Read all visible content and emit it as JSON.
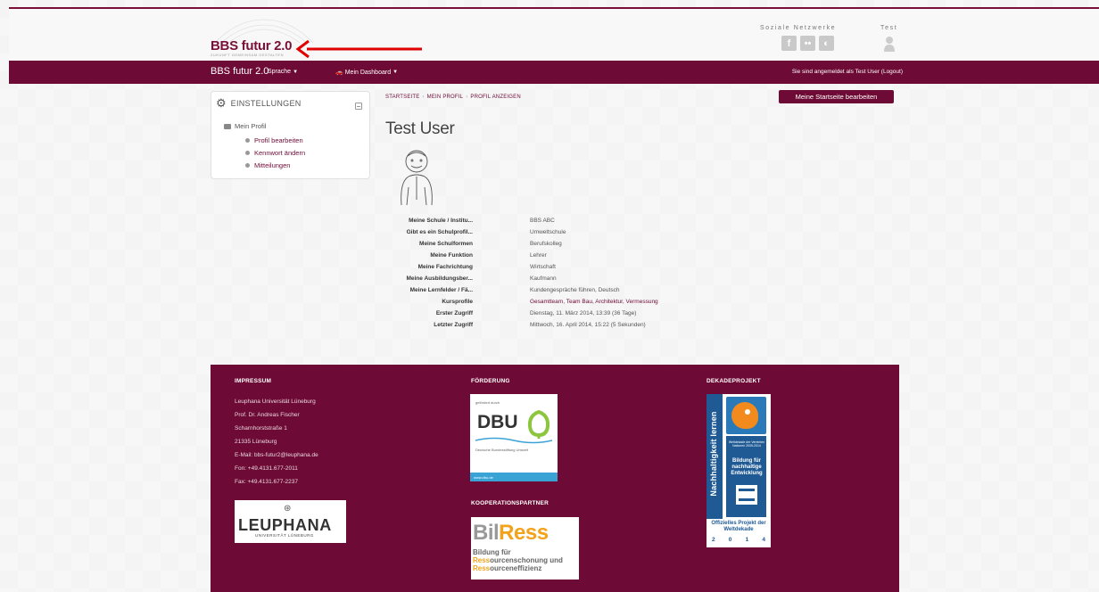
{
  "header": {
    "logo_title": "BBS futur 2.0",
    "logo_sub": "ZUKUNFT GEMEINSAM GESTALTEN",
    "social_title": "Soziale Netzwerke",
    "test_title": "Test",
    "social_icons": [
      "facebook-icon",
      "flickr-icon",
      "circle-icon"
    ]
  },
  "nav": {
    "brand": "BBS futur 2.0",
    "language": "Sprache",
    "dashboard": "Mein Dashboard",
    "login_status": "Sie sind angemeldet als Test User (Logout)"
  },
  "settings": {
    "title": "EINSTELLUNGEN",
    "root": "Mein Profil",
    "items": [
      "Profil bearbeiten",
      "Kennwort ändern",
      "Mitteilungen"
    ]
  },
  "breadcrumb": [
    "STARTSEITE",
    "MEIN PROFIL",
    "PROFIL ANZEIGEN"
  ],
  "edit_button": "Meine Startseite bearbeiten",
  "profile": {
    "name": "Test User",
    "rows": [
      {
        "label": "Meine Schule / Institu...",
        "value": "BBS ABC"
      },
      {
        "label": "Gibt es ein Schulprofil...",
        "value": "Umweltschule"
      },
      {
        "label": "Meine Schulformen",
        "value": "Berufskolleg"
      },
      {
        "label": "Meine Funktion",
        "value": "Lehrer"
      },
      {
        "label": "Meine Fachrichtung",
        "value": "Wirtschaft"
      },
      {
        "label": "Meine Ausbildungsber...",
        "value": "Kaufmann"
      },
      {
        "label": "Meine Lernfelder / Fä...",
        "value": "Kundengespräche führen, Deutsch"
      },
      {
        "label": "Kursprofile",
        "value": "Gesamtteam, Team Bau, Architektur, Vermessung"
      },
      {
        "label": "Erster Zugriff",
        "value": "Dienstag, 11. März 2014, 13:39  (36 Tage)"
      },
      {
        "label": "Letzter Zugriff",
        "value": "Mittwoch, 16. April 2014, 15:22  (5 Sekunden)"
      }
    ]
  },
  "footer": {
    "impressum_title": "IMPRESSUM",
    "impressum_lines": [
      "Leuphana Universität Lüneburg",
      "Prof. Dr. Andreas Fischer",
      "Scharnhorststraße 1",
      "21335 Lüneburg",
      "E-Mail:  bbs-futur2@leuphana.de",
      "Fon:     +49.4131.677-2011",
      "Fax:     +49.4131.677-2237"
    ],
    "leuphana_name": "LEUPHANA",
    "leuphana_sub": "UNIVERSITÄT LÜNEBURG",
    "foerderung_title": "FÖRDERUNG",
    "dbu_top": "gefördert durch",
    "dbu_name": "DBU",
    "dbu_sub": "Deutsche Bundesstiftung Umwelt",
    "dbu_url": "www.dbu.de",
    "koop_title": "KOOPERATIONSPARTNER",
    "bilress_bil": "Bil",
    "bilress_ress": "Ress",
    "bilress_l1": "Bildung für",
    "bilress_l2a": "Ress",
    "bilress_l2b": "ourcenschonung und",
    "bilress_l3a": "Ress",
    "bilress_l3b": "ourceneffizienz",
    "dekade_title": "DEKADEPROJEKT",
    "dekade_vertical": "Nachhaltigkeit lernen",
    "dekade_small": "Weltdekade der Vereinten Nationen 2005-2014",
    "dekade_bfne": "Bildung für nachhaltige Entwicklung",
    "dekade_official": "Offizielles Projekt der Weltdekade",
    "dekade_year": [
      "2",
      "0",
      "1",
      "4"
    ]
  },
  "colors": {
    "brand": "#6d0a35",
    "arrow": "#e00000"
  }
}
